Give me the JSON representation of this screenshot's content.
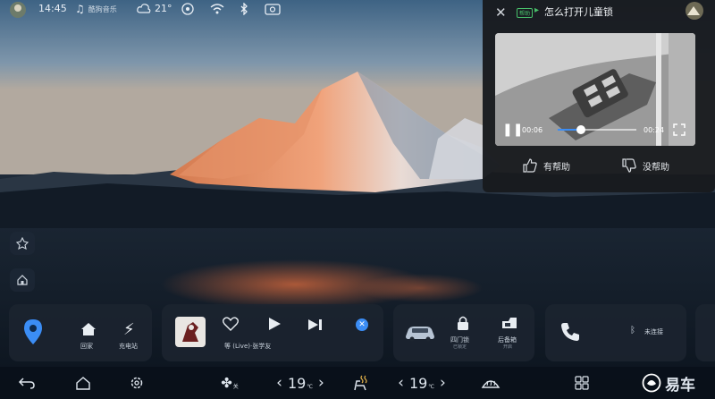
{
  "status_bar": {
    "time": "14:45",
    "music_app": "酷狗音乐",
    "temperature": "21°",
    "icons": [
      "avatar-icon",
      "music-note-icon",
      "weather-cloud-icon",
      "signal-icon",
      "wifi-icon",
      "bluetooth-icon",
      "screen-icon"
    ]
  },
  "help_popup": {
    "badge": "帮助",
    "title": "怎么打开儿童锁",
    "video": {
      "time_current": "00:06",
      "time_total": "00:24",
      "progress_fraction": 0.3
    },
    "helpful_label": "有帮助",
    "not_helpful_label": "没帮助"
  },
  "dock": {
    "nav_card": {
      "home_label": "回家",
      "charge_label": "充电站"
    },
    "music_card": {
      "song_label": "等 (Live)·张学友"
    },
    "car_card": {
      "lock_label": "四门锁",
      "lock_sub": "已锁定",
      "trunk_label": "后备箱",
      "trunk_sub": "开启"
    },
    "phone_card": {
      "bt_status": "未连接"
    }
  },
  "bottom_bar": {
    "fan_label": "关",
    "left_temp": "19",
    "left_temp_unit": "℃",
    "right_temp": "19",
    "right_temp_unit": "℃",
    "left_arrow": "‹",
    "right_arrow": "›"
  },
  "watermark": "易车",
  "colors": {
    "accent_blue": "#3b8df5",
    "card_bg": "#1c2430",
    "popup_bg": "#181a1e"
  }
}
